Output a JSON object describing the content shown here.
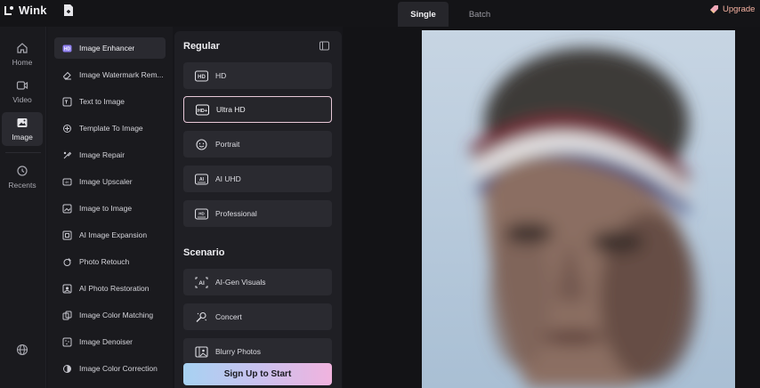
{
  "app": {
    "name": "Wink"
  },
  "header": {
    "tabs": [
      {
        "label": "Single",
        "active": true
      },
      {
        "label": "Batch",
        "active": false
      }
    ],
    "upgrade_label": "Upgrade"
  },
  "nav": {
    "items": [
      {
        "label": "Home",
        "icon": "home-icon"
      },
      {
        "label": "Video",
        "icon": "video-icon"
      },
      {
        "label": "Image",
        "icon": "image-icon",
        "active": true
      },
      {
        "label": "Recents",
        "icon": "history-icon"
      }
    ]
  },
  "tools": {
    "items": [
      {
        "label": "Image Enhancer",
        "icon": "hd-icon",
        "active": true
      },
      {
        "label": "Image Watermark Rem...",
        "icon": "eraser-icon"
      },
      {
        "label": "Text to Image",
        "icon": "text-image-icon"
      },
      {
        "label": "Template To Image",
        "icon": "template-icon"
      },
      {
        "label": "Image Repair",
        "icon": "repair-icon"
      },
      {
        "label": "Image Upscaler",
        "icon": "upscale-icon"
      },
      {
        "label": "Image to Image",
        "icon": "image-to-image-icon"
      },
      {
        "label": "AI Image Expansion",
        "icon": "expand-icon"
      },
      {
        "label": "Photo Retouch",
        "icon": "retouch-icon"
      },
      {
        "label": "AI Photo Restoration",
        "icon": "restore-icon"
      },
      {
        "label": "Image Color Matching",
        "icon": "color-match-icon"
      },
      {
        "label": "Image Denoiser",
        "icon": "denoise-icon"
      },
      {
        "label": "Image Color Correction",
        "icon": "color-correct-icon"
      }
    ]
  },
  "options": {
    "regular_title": "Regular",
    "regular": [
      {
        "label": "HD",
        "icon": "hd-badge-icon"
      },
      {
        "label": "Ultra HD",
        "icon": "hd-plus-icon",
        "selected": true
      },
      {
        "label": "Portrait",
        "icon": "smile-icon"
      },
      {
        "label": "AI UHD",
        "icon": "ai-badge-icon"
      },
      {
        "label": "Professional",
        "icon": "pro-badge-icon"
      }
    ],
    "scenario_title": "Scenario",
    "scenario": [
      {
        "label": "AI-Gen Visuals",
        "icon": "ai-visuals-icon"
      },
      {
        "label": "Concert",
        "icon": "concert-icon"
      },
      {
        "label": "Blurry Photos",
        "icon": "blurry-photo-icon"
      }
    ],
    "cta_label": "Sign Up to Start"
  },
  "colors": {
    "accent_gradient_start": "#a7d2f2",
    "accent_gradient_end": "#f1b3de",
    "selected_border": "#e7c7d7",
    "upgrade": "#f7b2a2"
  }
}
